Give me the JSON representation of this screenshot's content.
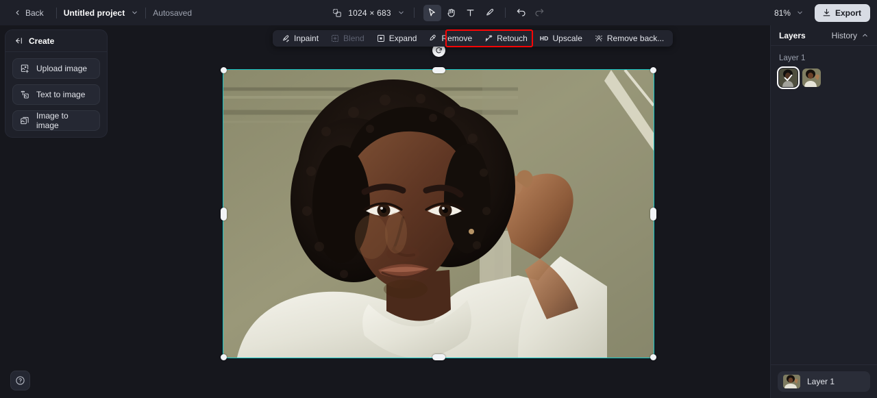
{
  "topbar": {
    "back_label": "Back",
    "project_name": "Untitled project",
    "autosaved_label": "Autosaved",
    "canvas_size": "1024 × 683",
    "zoom_level": "81%",
    "export_label": "Export",
    "tools": [
      {
        "name": "select-tool",
        "icon": "cursor-icon",
        "active": true,
        "disabled": false
      },
      {
        "name": "pan-tool",
        "icon": "hand-icon",
        "active": false,
        "disabled": false
      },
      {
        "name": "text-tool",
        "icon": "text-icon",
        "active": false,
        "disabled": false
      },
      {
        "name": "brush-tool",
        "icon": "brush-icon",
        "active": false,
        "disabled": false
      },
      {
        "name": "undo-button",
        "icon": "undo-icon",
        "active": false,
        "disabled": false
      },
      {
        "name": "redo-button",
        "icon": "redo-icon",
        "active": false,
        "disabled": true
      }
    ]
  },
  "left_panel": {
    "header": "Create",
    "items": [
      {
        "label": "Upload image",
        "icon": "upload-image-icon"
      },
      {
        "label": "Text to image",
        "icon": "text-to-image-icon"
      },
      {
        "label": "Image to image",
        "icon": "image-to-image-icon"
      }
    ]
  },
  "edit_toolbar": {
    "highlight_color": "#fb0505",
    "items": [
      {
        "label": "Inpaint",
        "icon": "inpaint-icon",
        "disabled": false,
        "badge": ""
      },
      {
        "label": "Blend",
        "icon": "blend-icon",
        "disabled": true,
        "badge": ""
      },
      {
        "label": "Expand",
        "icon": "expand-icon",
        "disabled": false,
        "badge": ""
      },
      {
        "label": "Remove",
        "icon": "remove-icon",
        "disabled": false,
        "badge": ""
      },
      {
        "label": "Retouch",
        "icon": "retouch-icon",
        "disabled": false,
        "badge": ""
      },
      {
        "label": "Upscale",
        "icon": "",
        "disabled": false,
        "badge": "HD"
      },
      {
        "label": "Remove back...",
        "icon": "remove-background-icon",
        "disabled": false,
        "badge": ""
      }
    ]
  },
  "canvas": {
    "selection_color": "#14c8c8",
    "rotate_icon": "rotate-icon",
    "image_description": "Portrait of a young woman with natural afro hair, hand raised to her head, wearing a cream turtleneck, olive-green wall background"
  },
  "right_panel": {
    "title": "Layers",
    "history_label": "History",
    "layer_group_label": "Layer 1",
    "thumbnails": [
      {
        "name": "mask-thumbnail",
        "selected": true
      },
      {
        "name": "image-thumbnail",
        "selected": false
      }
    ],
    "layer_row_label": "Layer 1"
  },
  "help": {
    "icon": "help-icon"
  }
}
